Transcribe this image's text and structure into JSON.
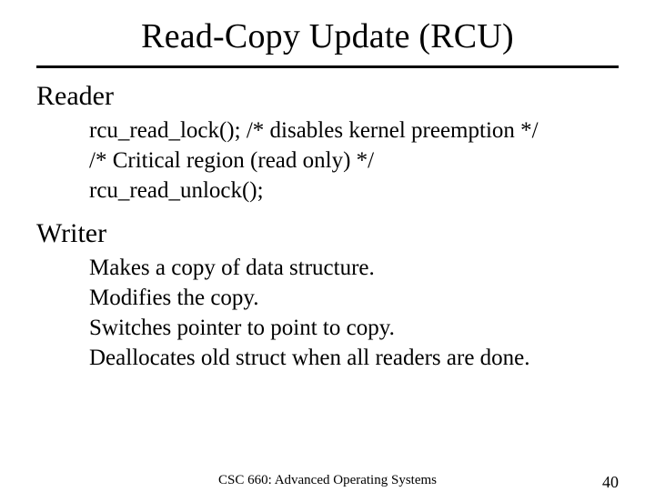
{
  "title": "Read-Copy Update (RCU)",
  "reader": {
    "heading": "Reader",
    "lines": [
      "rcu_read_lock(); /* disables kernel preemption */",
      "/* Critical region (read only) */",
      "rcu_read_unlock();"
    ]
  },
  "writer": {
    "heading": "Writer",
    "lines": [
      "Makes a copy of data structure.",
      "Modifies the copy.",
      "Switches pointer to point to copy.",
      "Deallocates old struct when all readers are done."
    ]
  },
  "footer": {
    "course": "CSC 660: Advanced Operating Systems",
    "page": "40"
  }
}
